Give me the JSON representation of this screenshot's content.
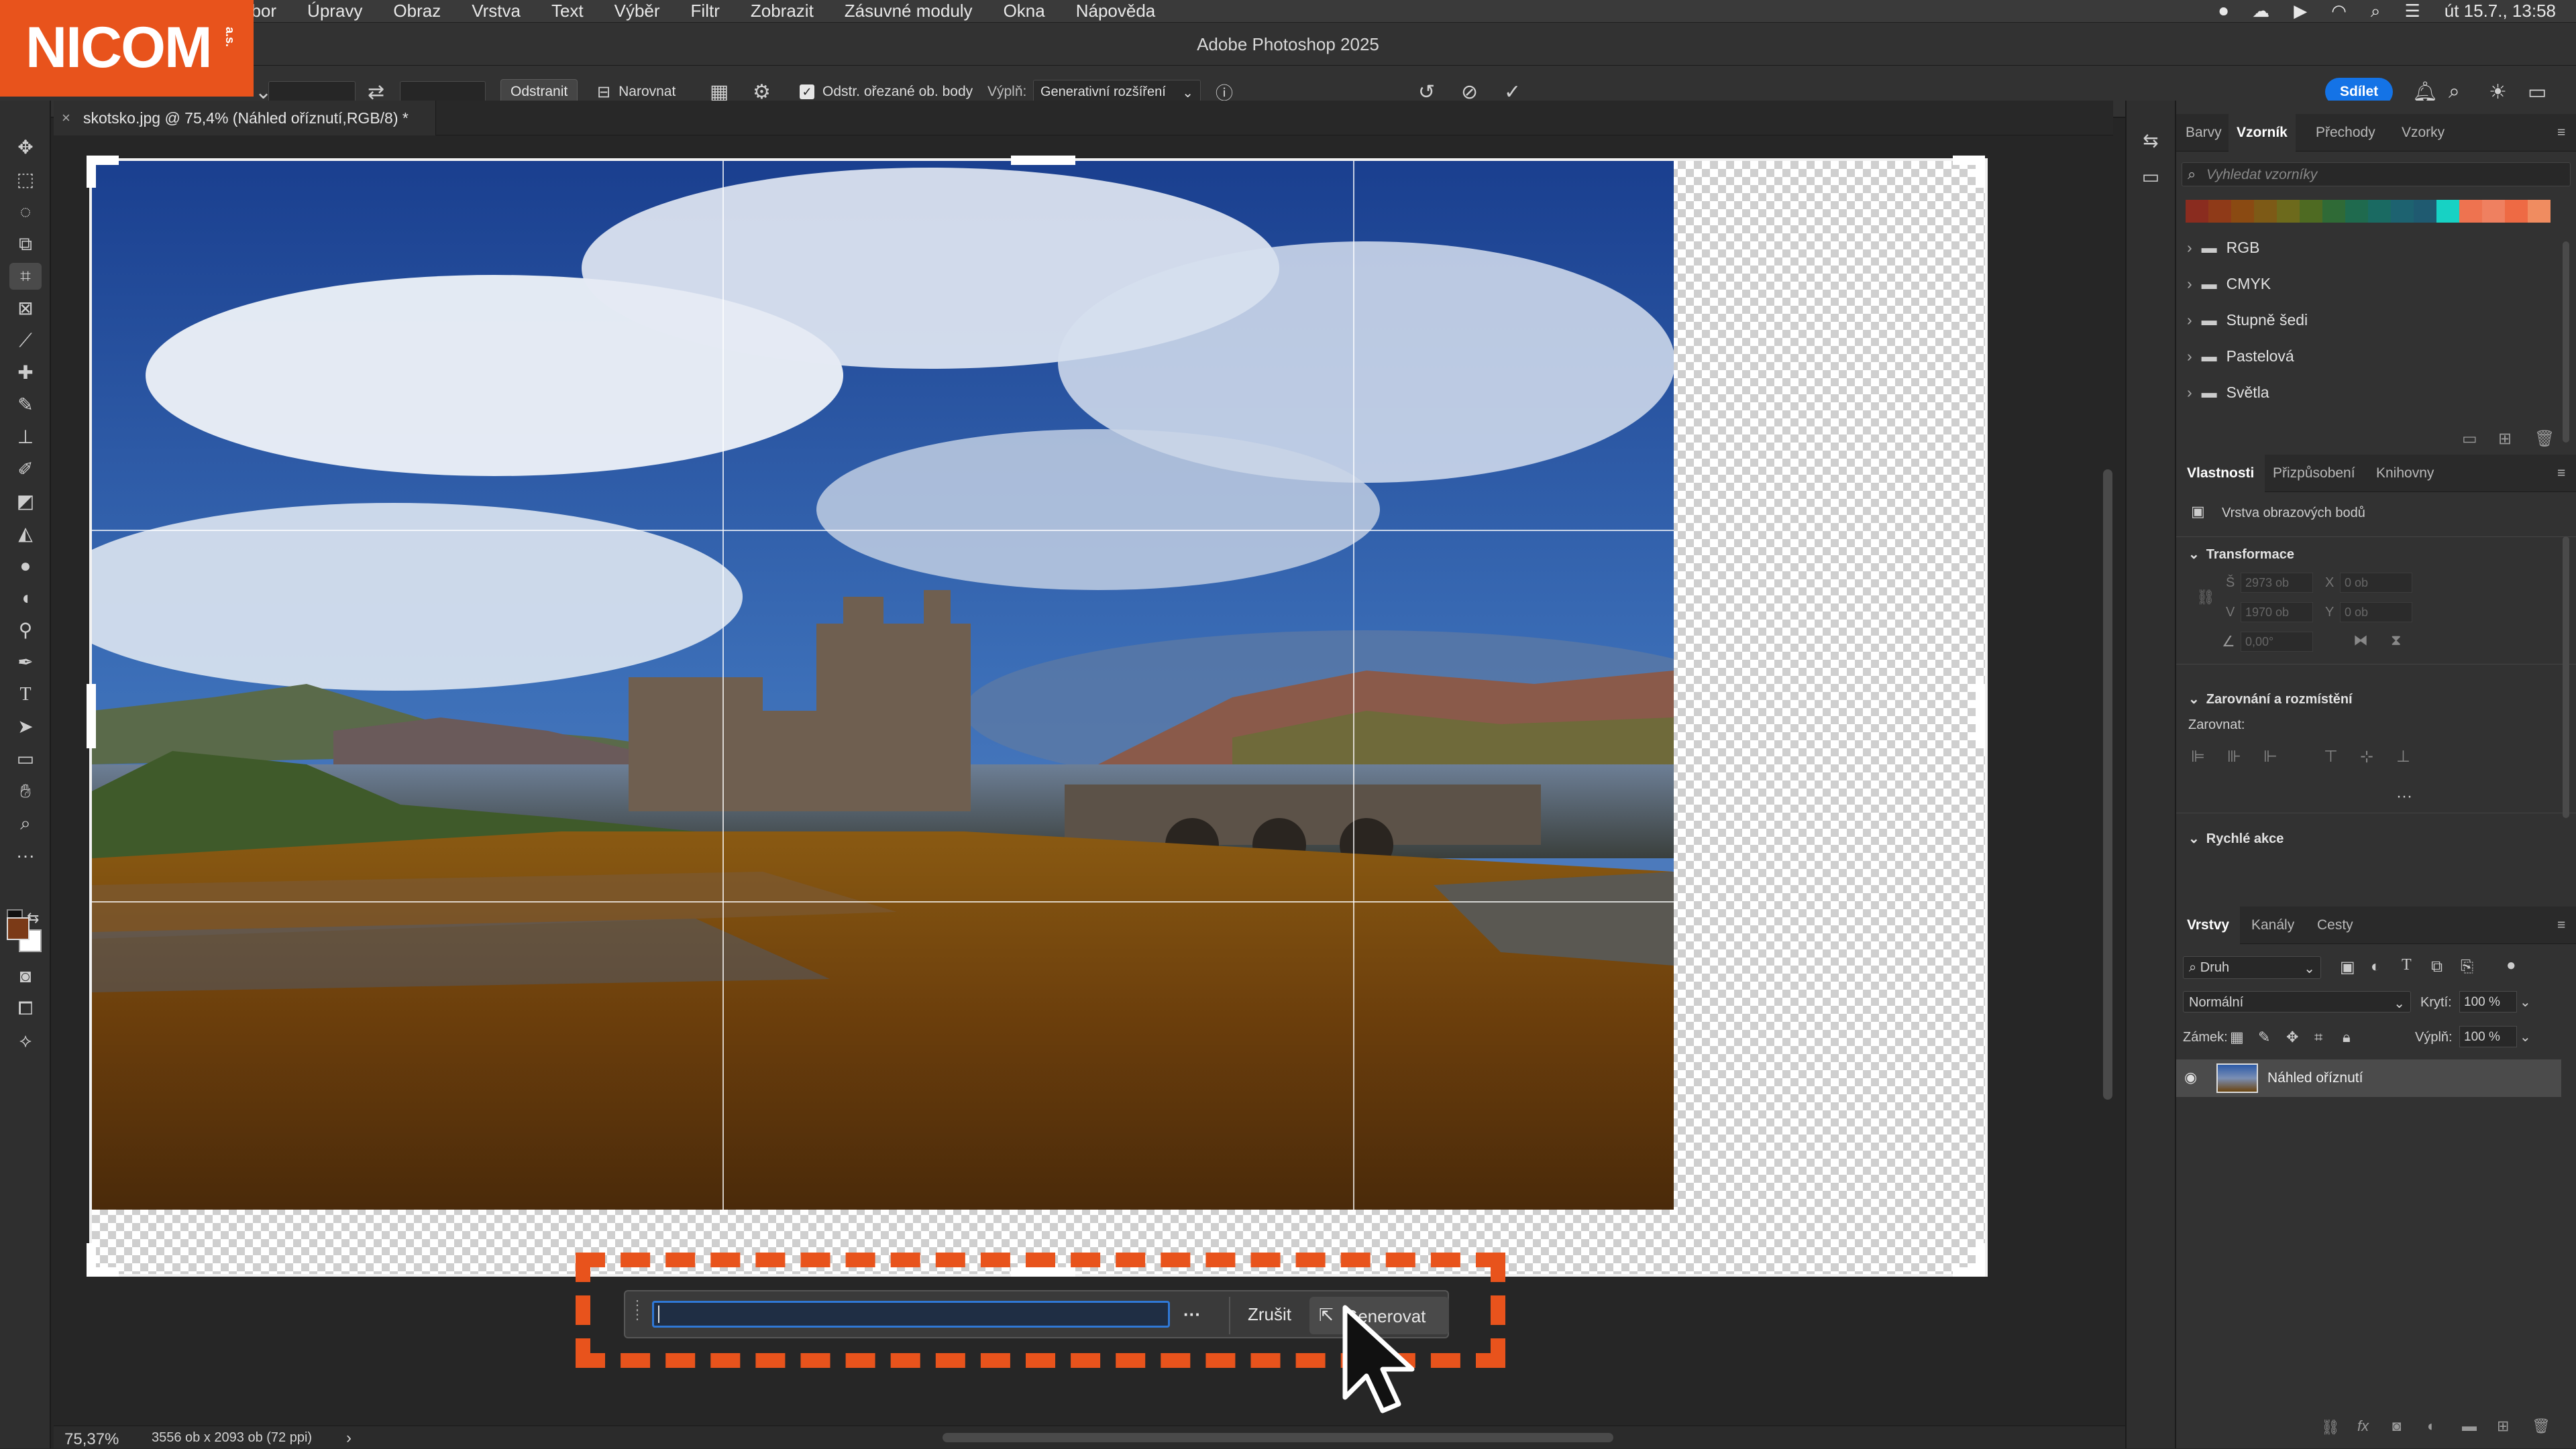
{
  "logo": {
    "text": "NICOM",
    "sub": "a.s."
  },
  "menubar": {
    "items": [
      "abor",
      "Úpravy",
      "Obraz",
      "Vrstva",
      "Text",
      "Výběr",
      "Filtr",
      "Zobrazit",
      "Zásuvné moduly",
      "Okna",
      "Nápověda"
    ],
    "clock": "út 15.7., 13:58"
  },
  "titlebar": {
    "title": "Adobe Photoshop 2025"
  },
  "options": {
    "remove_label": "Odstranit",
    "straighten_label": "Narovnat",
    "delete_cropped_label": "Odstr. ořezané ob. body",
    "delete_cropped_checked": true,
    "fill_label": "Výplň:",
    "fill_value": "Generativní rozšíření",
    "share_label": "Sdílet"
  },
  "document": {
    "tab_label": "skotsko.jpg @ 75,4% (Náhled oříznutí,RGB/8) *"
  },
  "generate_bar": {
    "prompt_value": "",
    "more_label": "···",
    "cancel_label": "Zrušit",
    "generate_label": "Generovat"
  },
  "status": {
    "zoom": "75,37%",
    "doc_info": "3556 ob x 2093 ob (72 ppi)",
    "arrow": "›"
  },
  "swatches_panel": {
    "tabs": [
      "Barvy",
      "Vzorník",
      "Přechody",
      "Vzorky"
    ],
    "active_tab": "Vzorník",
    "search_placeholder": "Vyhledat vzorníky",
    "colors": [
      "#8a2c1f",
      "#8f3a18",
      "#8a4a12",
      "#7d5a16",
      "#6d6a1c",
      "#4e6a22",
      "#2f6a36",
      "#1f6a4e",
      "#1a6a62",
      "#1d6270",
      "#1f5a70",
      "#17d2c4",
      "#ee7350",
      "#ef8060",
      "#ee6a44",
      "#f08c60"
    ],
    "folders": [
      "RGB",
      "CMYK",
      "Stupně šedi",
      "Pastelová",
      "Světla"
    ]
  },
  "properties_panel": {
    "tabs": [
      "Vlastnosti",
      "Přizpůsobení",
      "Knihovny"
    ],
    "active_tab": "Vlastnosti",
    "layer_type": "Vrstva obrazových bodů",
    "transform_title": "Transformace",
    "w_label": "Š",
    "w_value": "2973 ob",
    "x_label": "X",
    "x_value": "0 ob",
    "h_label": "V",
    "h_value": "1970 ob",
    "y_label": "Y",
    "y_value": "0 ob",
    "angle_value": "0,00°",
    "align_title": "Zarovnání a rozmístění",
    "align_label": "Zarovnat:",
    "quick_title": "Rychlé akce",
    "more": "···"
  },
  "layers_panel": {
    "tabs": [
      "Vrstvy",
      "Kanály",
      "Cesty"
    ],
    "active_tab": "Vrstvy",
    "filter_label": "Druh",
    "blend_mode": "Normální",
    "opacity_label": "Krytí:",
    "opacity_value": "100 %",
    "lock_label": "Zámek:",
    "fill_label": "Výplň:",
    "fill_value": "100 %",
    "layers": [
      {
        "name": "Náhled oříznutí",
        "visible": true
      }
    ]
  }
}
